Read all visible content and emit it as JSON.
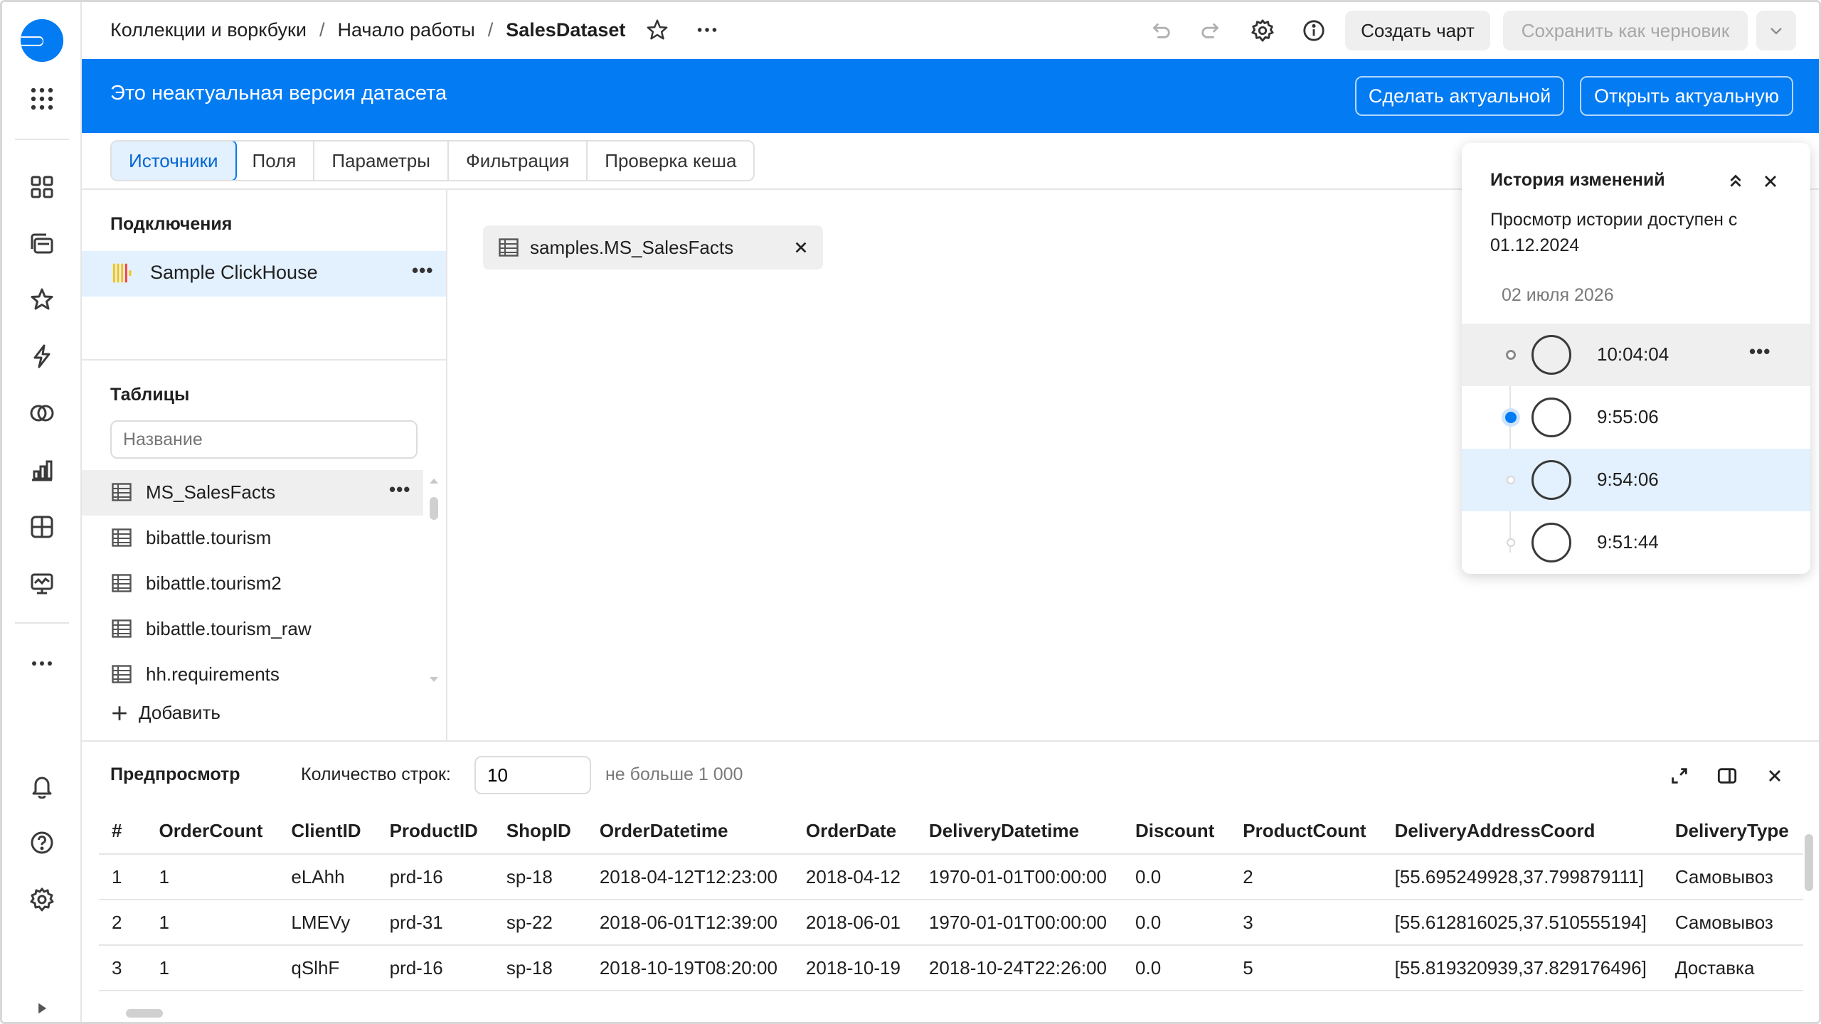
{
  "breadcrumbs": [
    "Коллекции и воркбуки",
    "Начало работы",
    "SalesDataset"
  ],
  "breadcrumb_sep": "/",
  "topbar": {
    "create_chart": "Создать чарт",
    "save_draft": "Сохранить как черновик"
  },
  "banner": {
    "text": "Это неактуальная версия датасета",
    "make_actual": "Сделать актуальной",
    "open_actual": "Открыть актуальную",
    "bg_color": "#027bf3"
  },
  "tabs": [
    "Источники",
    "Поля",
    "Параметры",
    "Фильтрация",
    "Проверка кеша"
  ],
  "connections": {
    "title": "Подключения",
    "items": [
      {
        "label": "Sample ClickHouse",
        "icon": "clickhouse-icon"
      }
    ]
  },
  "tables": {
    "title": "Таблицы",
    "search_placeholder": "Название",
    "items": [
      "MS_SalesFacts",
      "bibattle.tourism",
      "bibattle.tourism2",
      "bibattle.tourism_raw",
      "hh.requirements"
    ],
    "add_label": "Добавить"
  },
  "source_chip": "samples.MS_SalesFacts",
  "history": {
    "title": "История изменений",
    "description": "Просмотр истории доступен с 01.12.2024",
    "date": "02 июля 2026",
    "entries": [
      "10:04:04",
      "9:55:06",
      "9:54:06",
      "9:51:44"
    ]
  },
  "preview": {
    "title": "Предпросмотр",
    "rows_label": "Количество строк:",
    "rows_value": "10",
    "rows_hint": "не больше 1 000",
    "columns": [
      "#",
      "OrderCount",
      "ClientID",
      "ProductID",
      "ShopID",
      "OrderDatetime",
      "OrderDate",
      "DeliveryDatetime",
      "Discount",
      "ProductCount",
      "DeliveryAddressCoord",
      "DeliveryType"
    ],
    "rows": [
      [
        "1",
        "1",
        "eLAhh",
        "prd-16",
        "sp-18",
        "2018-04-12T12:23:00",
        "2018-04-12",
        "1970-01-01T00:00:00",
        "0.0",
        "2",
        "[55.695249928,37.799879111]",
        "Самовывоз"
      ],
      [
        "2",
        "1",
        "LMEVy",
        "prd-31",
        "sp-22",
        "2018-06-01T12:39:00",
        "2018-06-01",
        "1970-01-01T00:00:00",
        "0.0",
        "3",
        "[55.612816025,37.510555194]",
        "Самовывоз"
      ],
      [
        "3",
        "1",
        "qSlhF",
        "prd-16",
        "sp-18",
        "2018-10-19T08:20:00",
        "2018-10-19",
        "2018-10-24T22:26:00",
        "0.0",
        "5",
        "[55.819320939,37.829176496]",
        "Доставка"
      ]
    ]
  }
}
